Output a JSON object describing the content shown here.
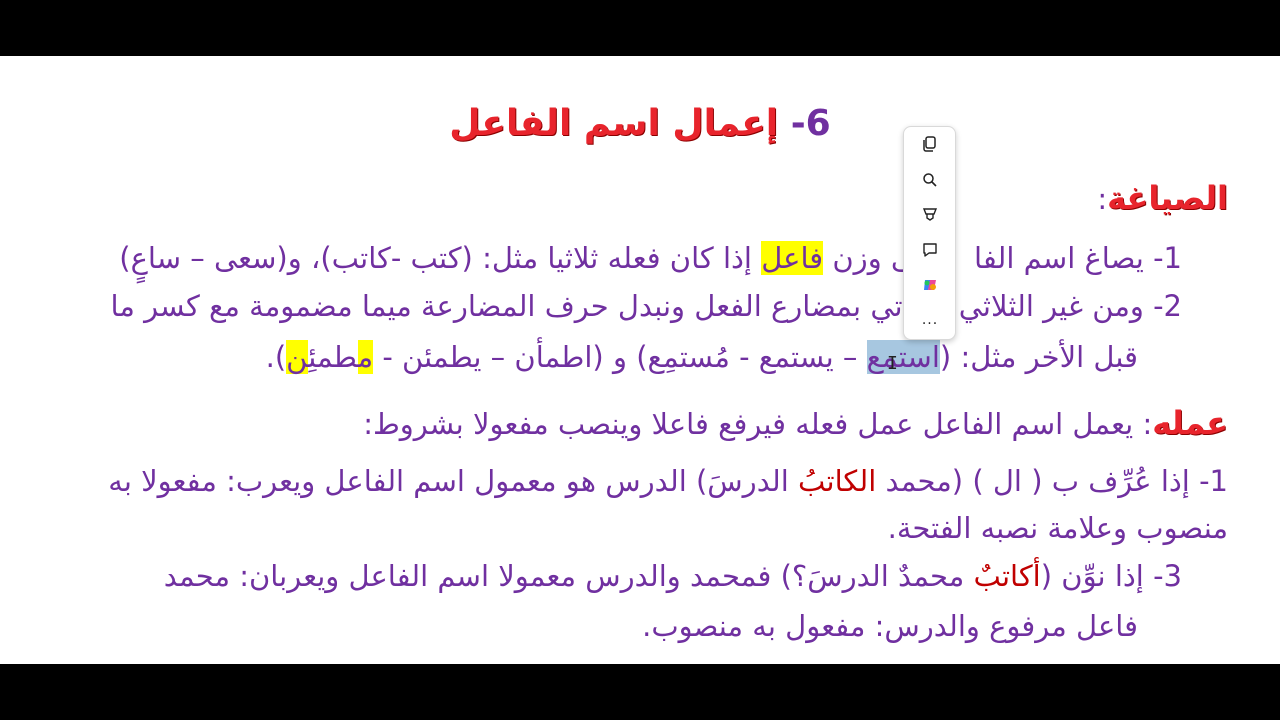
{
  "slide": {
    "title_num": "6-",
    "title_text": "إعمال اسم الفاعل",
    "heading1": "الصياغة",
    "colon": ":",
    "line1": {
      "before": "1- يصاغ اسم الفا",
      "middle": "على وزن ",
      "hl_word": "فاعل",
      "after": " إذا كان فعله ثلاثيا مثل: (كتب -كاتب)، و(سعى – ساعٍ)"
    },
    "line2": {
      "part1": "2- ومن غير الثلاثي",
      "part2": " نأتي بمضارع الفعل ونبدل حرف المضارعة ميما مضمومة مع كسر ما"
    },
    "line3": {
      "part1": "قبل الأخر مثل: (",
      "selected": "استمع",
      "part2": " – يستمع - مُستمِع) و (اطمأن – يطمئن - ",
      "hl_m": "م",
      "part3": "طمئِ",
      "hl_n": "ن",
      "part4": ")."
    },
    "heading2": "عمله",
    "line4": "يعمل اسم الفاعل عمل فعله فيرفع فاعلا وينصب مفعولا بشروط:",
    "line5": {
      "part1": "1- إذا عُرِّف ب ( ال ) (محمد ",
      "red": "الكاتبُ",
      "part2": " الدرسَ) الدرس هو معمول اسم الفاعل ويعرب: مفعولا به"
    },
    "line6": "منصوب وعلامة نصبه الفتحة.",
    "line7": {
      "part1": "3- إذا نوِّن (",
      "red": "أكاتبٌ",
      "part2": " محمدٌ الدرسَ؟) فمحمد والدرس معمولا اسم الفاعل ويعربان: محمد"
    },
    "line8": "فاعل مرفوع والدرس: مفعول به منصوب."
  },
  "toolbar": {
    "items": [
      {
        "icon": "copy-icon"
      },
      {
        "icon": "search-icon"
      },
      {
        "icon": "highlighter-icon"
      },
      {
        "icon": "comment-icon"
      },
      {
        "icon": "copilot-icon"
      },
      {
        "icon": "more-icon",
        "label": "..."
      }
    ]
  },
  "colors": {
    "purple": "#7030a0",
    "red": "#e8242c",
    "highlight": "#ffff00",
    "selection": "#a7c7e0"
  }
}
